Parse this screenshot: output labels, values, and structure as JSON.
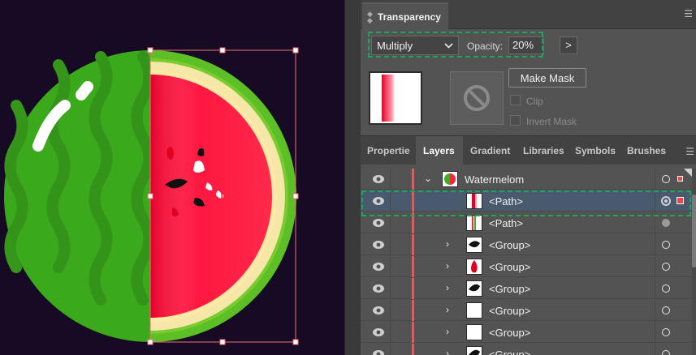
{
  "canvas": {
    "artwork": "watermelon-illustration",
    "colors": {
      "background": "#170a24",
      "rind": "#3fae1e",
      "flesh": "#ff2244",
      "selection": "#f06a6a"
    }
  },
  "transparency": {
    "title": "Transparency",
    "blend_mode": "Multiply",
    "opacity_label": "Opacity:",
    "opacity_value": "20%",
    "arrow_label": ">",
    "make_mask_label": "Make Mask",
    "clip_label": "Clip",
    "invert_mask_label": "Invert Mask"
  },
  "layers_panel": {
    "tabs": [
      {
        "label": "Propertie"
      },
      {
        "label": "Layers",
        "active": true
      },
      {
        "label": "Gradient"
      },
      {
        "label": "Libraries"
      },
      {
        "label": "Symbols"
      },
      {
        "label": "Brushes"
      }
    ],
    "rows": [
      {
        "name": "Watermelom",
        "thumb": "watermelon",
        "expanded": true
      },
      {
        "name": "<Path>",
        "thumb": "gradient-strip",
        "selected": true
      },
      {
        "name": "<Path>",
        "thumb": "stripe"
      },
      {
        "name": "<Group>",
        "thumb": "black-seed"
      },
      {
        "name": "<Group>",
        "thumb": "red-seed"
      },
      {
        "name": "<Group>",
        "thumb": "black-seed"
      },
      {
        "name": "<Group>",
        "thumb": "blank"
      },
      {
        "name": "<Group>",
        "thumb": "blank"
      },
      {
        "name": "<Group>",
        "thumb": "black-seed"
      }
    ]
  }
}
